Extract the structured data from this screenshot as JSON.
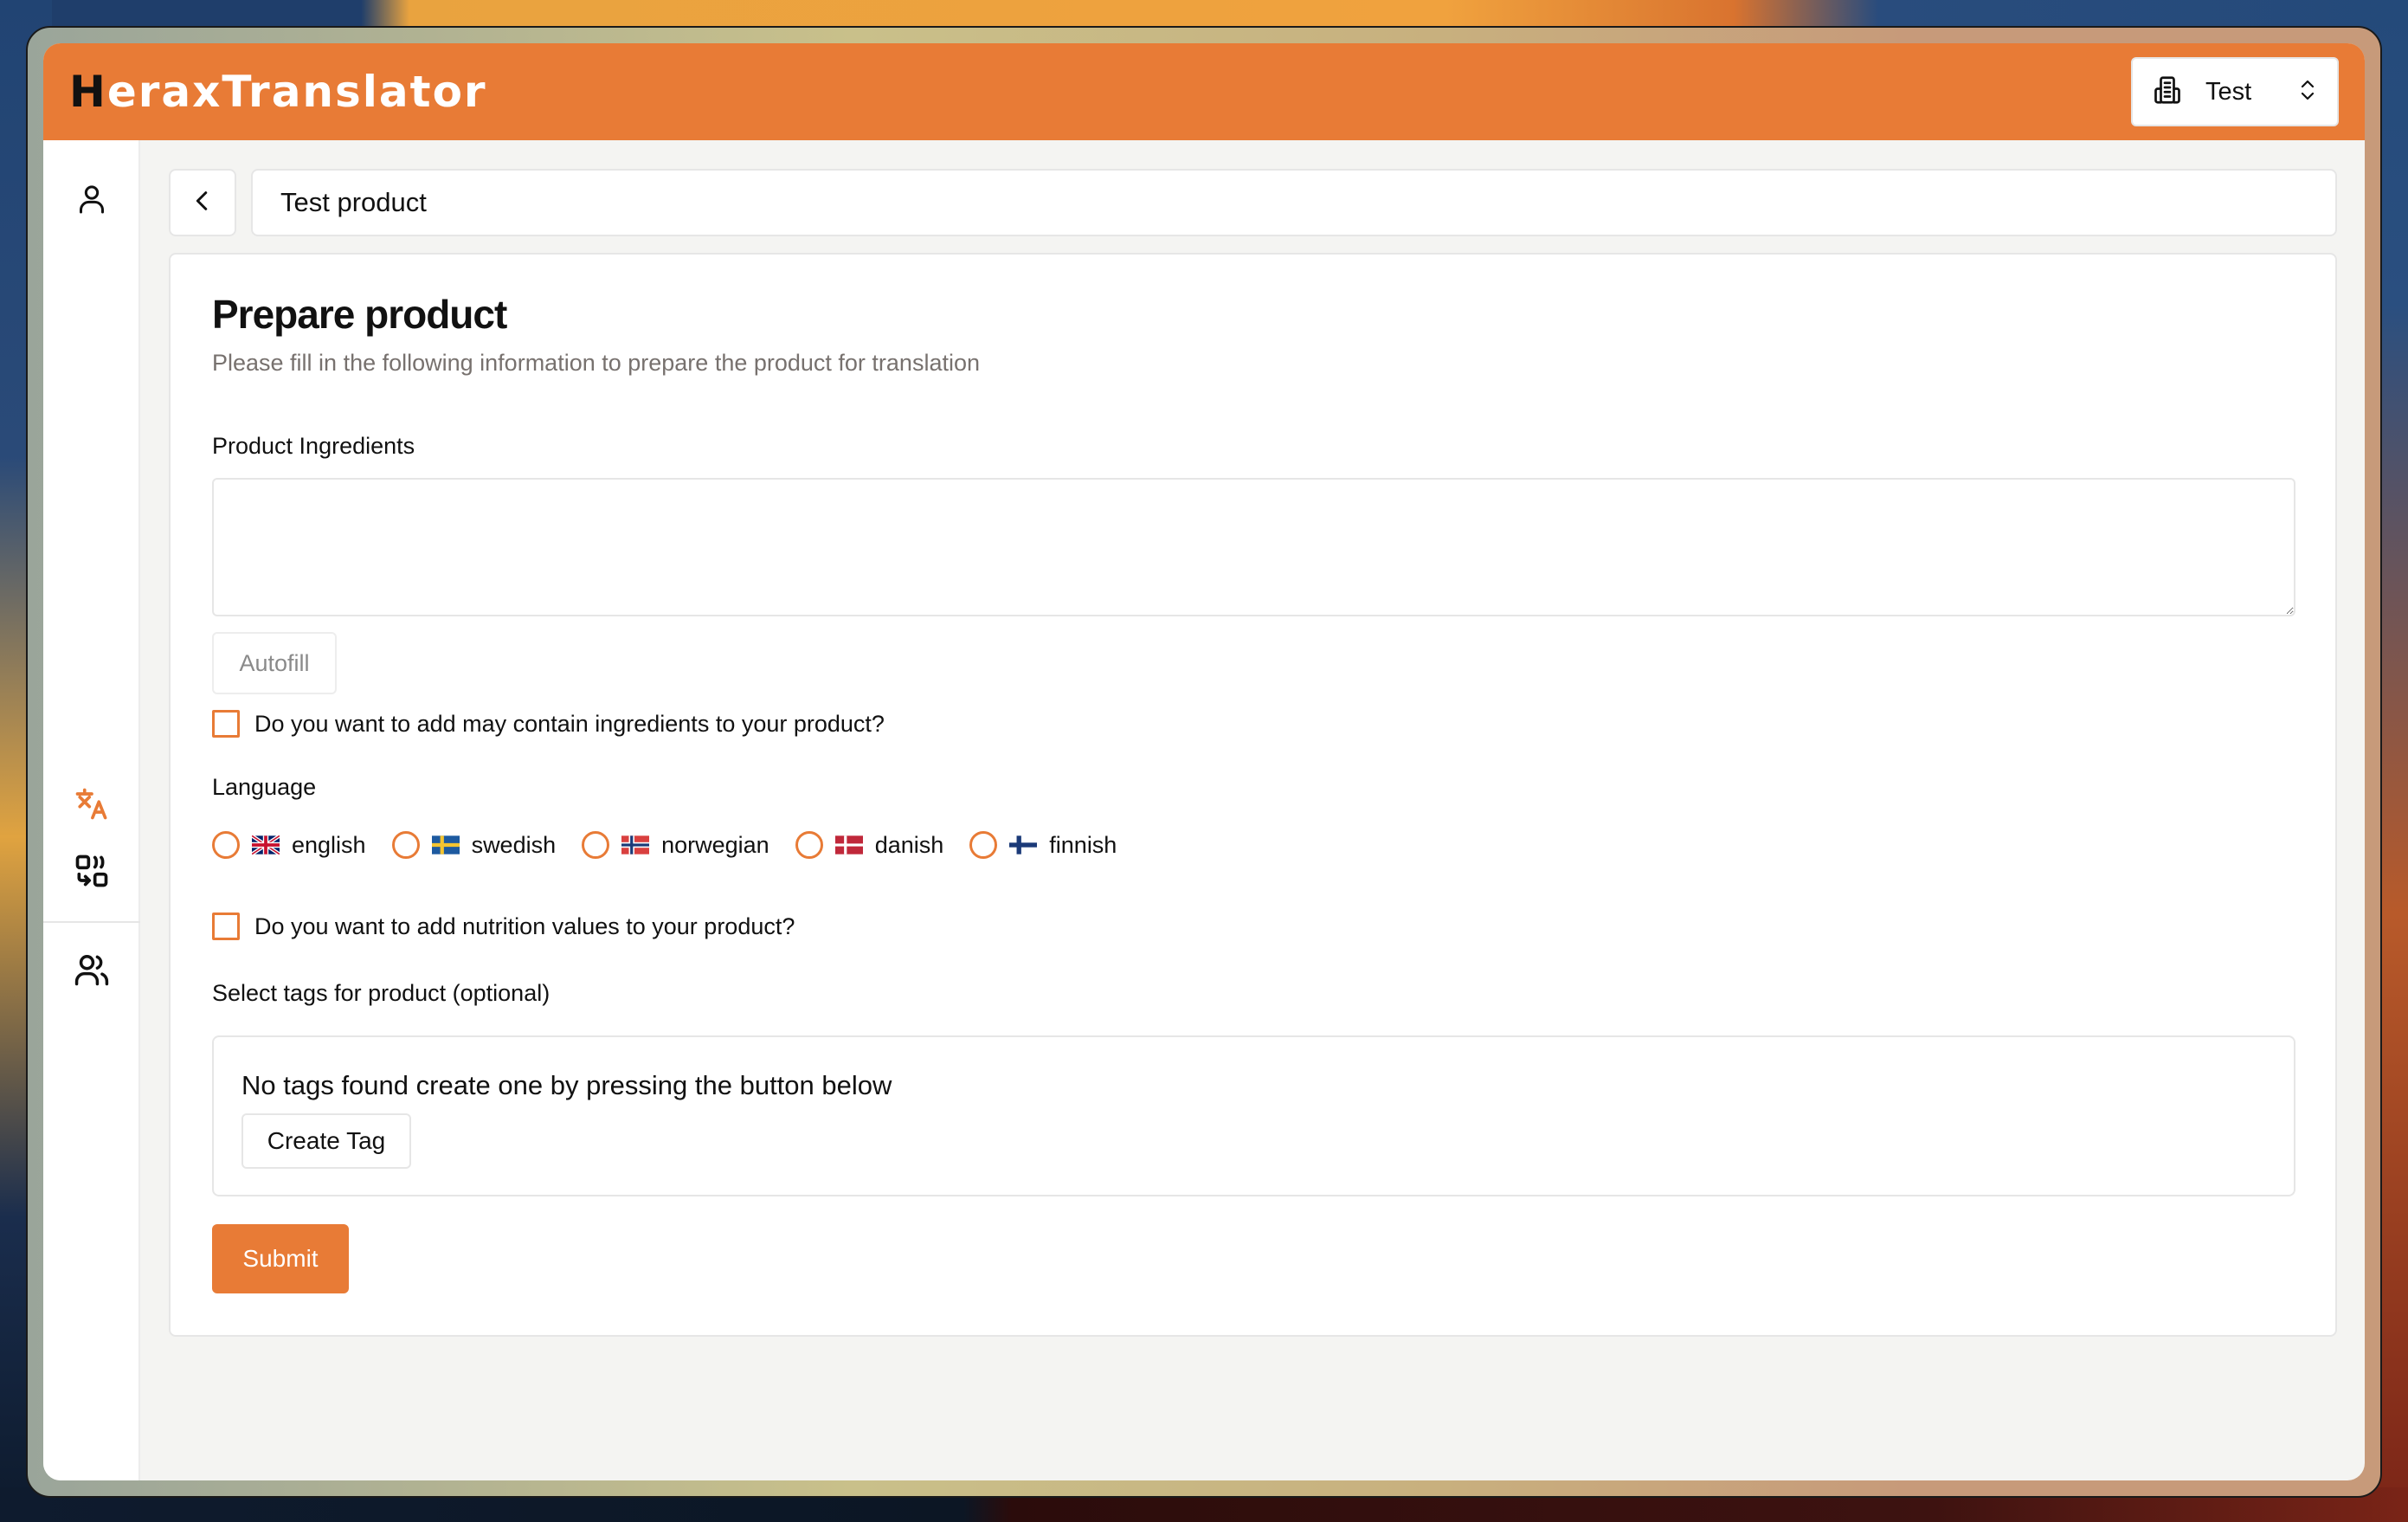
{
  "app": {
    "logo_first": "H",
    "logo_rest": "eraxTranslator",
    "brand_color": "#e87b36"
  },
  "org_switcher": {
    "icon": "building-icon",
    "name": "Test",
    "chevron": "chevron-up-down-icon"
  },
  "sidebar": {
    "items": [
      {
        "name": "profile",
        "icon": "user-icon",
        "active": false
      },
      {
        "name": "translate",
        "icon": "translate-icon",
        "active": true
      },
      {
        "name": "convert",
        "icon": "convert-icon",
        "active": false
      },
      {
        "name": "users",
        "icon": "users-icon",
        "active": false
      }
    ]
  },
  "topbar": {
    "back_icon": "chevron-left-icon",
    "product_name": "Test product"
  },
  "form": {
    "title": "Prepare product",
    "subtitle": "Please fill in the following information to prepare the product for translation",
    "ingredients_label": "Product Ingredients",
    "ingredients_value": "",
    "autofill_label": "Autofill",
    "may_contain_label": "Do you want to add may contain ingredients to your product?",
    "may_contain_checked": false,
    "language_label": "Language",
    "languages": [
      {
        "label": "english",
        "flag": "uk-flag-icon",
        "selected": false
      },
      {
        "label": "swedish",
        "flag": "sweden-flag-icon",
        "selected": false
      },
      {
        "label": "norwegian",
        "flag": "norway-flag-icon",
        "selected": false
      },
      {
        "label": "danish",
        "flag": "denmark-flag-icon",
        "selected": false
      },
      {
        "label": "finnish",
        "flag": "finland-flag-icon",
        "selected": false
      }
    ],
    "nutrition_label": "Do you want to add nutrition values to your product?",
    "nutrition_checked": false,
    "tags_label": "Select tags for product (optional)",
    "tags_empty_text": "No tags found create one by pressing the button below",
    "create_tag_label": "Create Tag",
    "submit_label": "Submit"
  }
}
